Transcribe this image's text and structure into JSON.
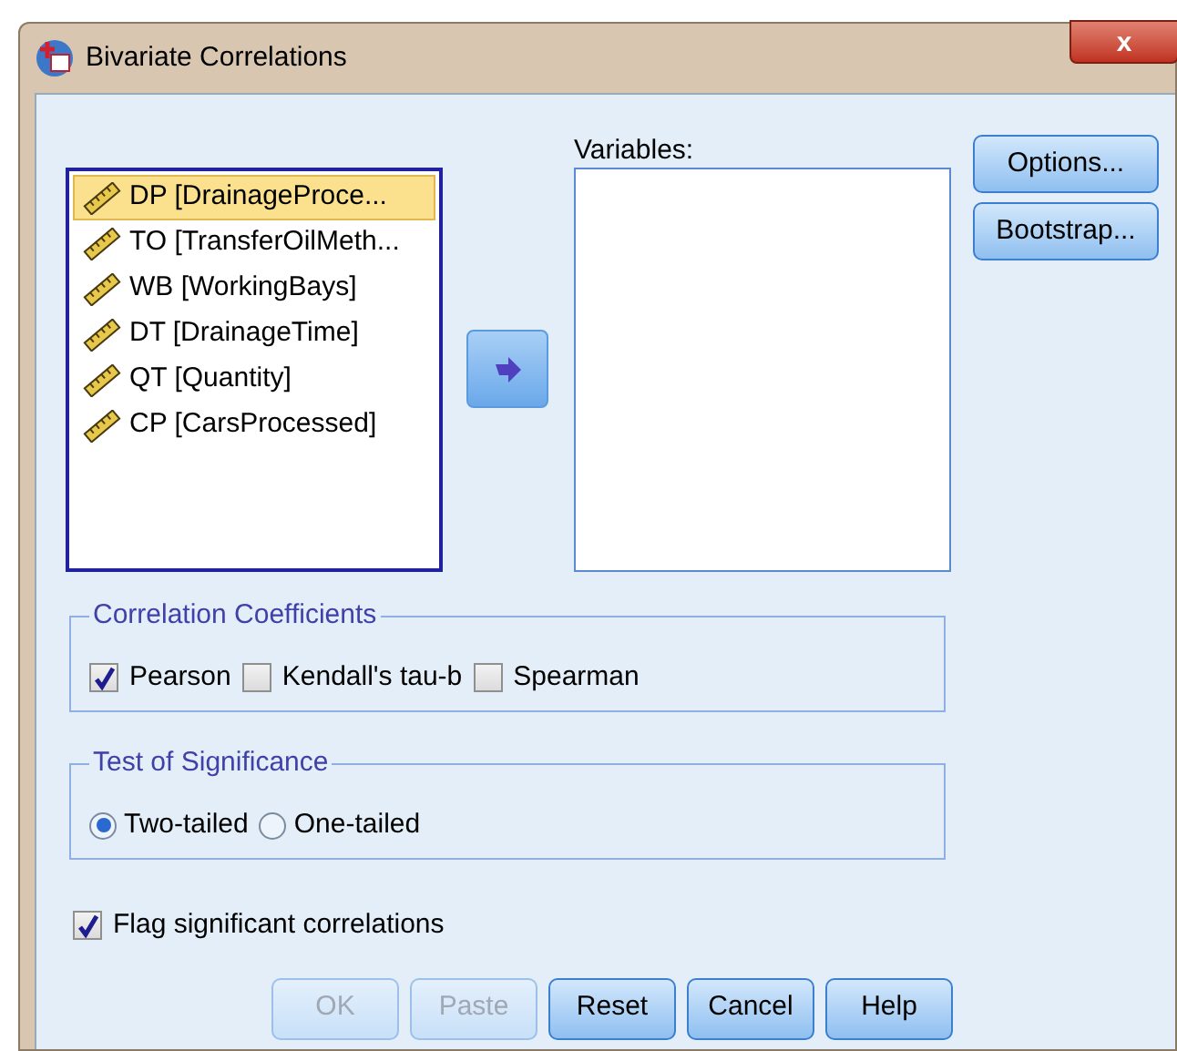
{
  "window": {
    "title": "Bivariate Correlations",
    "close": "x"
  },
  "source_list": [
    {
      "label": "DP [DrainageProce...",
      "selected": true
    },
    {
      "label": "TO [TransferOilMeth...",
      "selected": false
    },
    {
      "label": "WB [WorkingBays]",
      "selected": false
    },
    {
      "label": "DT [DrainageTime]",
      "selected": false
    },
    {
      "label": "QT [Quantity]",
      "selected": false
    },
    {
      "label": "CP [CarsProcessed]",
      "selected": false
    }
  ],
  "variables": {
    "label": "Variables:"
  },
  "side_buttons": [
    "Options...",
    "Bootstrap..."
  ],
  "correlation_coefficients": {
    "title": "Correlation Coefficients",
    "options": [
      {
        "label": "Pearson",
        "checked": true
      },
      {
        "label": "Kendall's tau-b",
        "checked": false
      },
      {
        "label": "Spearman",
        "checked": false
      }
    ]
  },
  "test_of_significance": {
    "title": "Test of Significance",
    "options": [
      {
        "label": "Two-tailed",
        "selected": true
      },
      {
        "label": "One-tailed",
        "selected": false
      }
    ]
  },
  "flag_significant": {
    "label": "Flag significant correlations",
    "checked": true
  },
  "buttons": [
    {
      "label": "OK",
      "disabled": true
    },
    {
      "label": "Paste",
      "disabled": true
    },
    {
      "label": "Reset",
      "disabled": false
    },
    {
      "label": "Cancel",
      "disabled": false
    },
    {
      "label": "Help",
      "disabled": false
    }
  ]
}
